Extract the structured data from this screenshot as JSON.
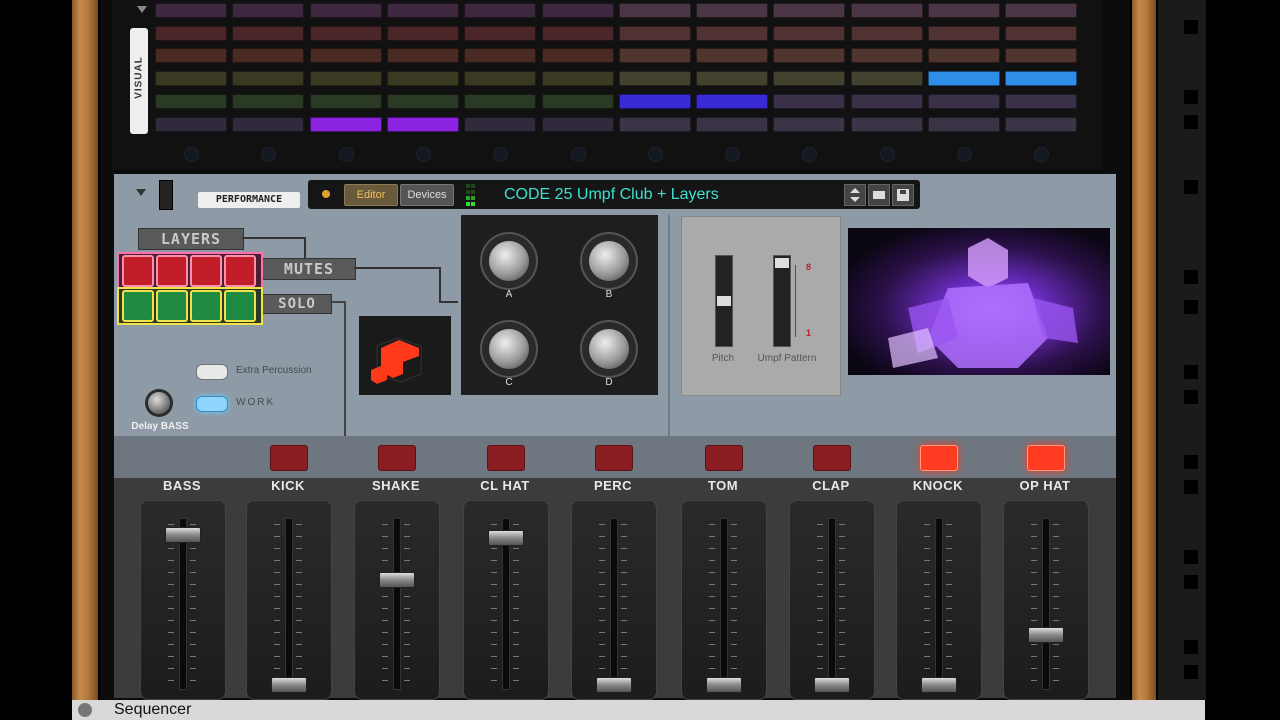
{
  "rack": {
    "visual_tab_label": "VISUAL",
    "grid_rows": [
      [
        "#3d2840",
        "#3d2840",
        "#3d2840",
        "#3d2840",
        "#3d2840",
        "#3d2840",
        "#4a3644",
        "#4a3644",
        "#4a3644",
        "#4a3644",
        "#4a3644",
        "#4a3644"
      ],
      [
        "#4a2628",
        "#4a2628",
        "#4a2628",
        "#4a2628",
        "#4a2628",
        "#4a2628",
        "#513232",
        "#513232",
        "#513232",
        "#513232",
        "#513232",
        "#513232"
      ],
      [
        "#4a2b24",
        "#4a2b24",
        "#4a2b24",
        "#4a2b24",
        "#4a2b24",
        "#4a2b24",
        "#50352e",
        "#50352e",
        "#50352e",
        "#50352e",
        "#50352e",
        "#50352e"
      ],
      [
        "#3a3a22",
        "#3a3a22",
        "#3a3a22",
        "#3a3a22",
        "#3a3a22",
        "#3a3a22",
        "#42422e",
        "#42422e",
        "#42422e",
        "#42422e",
        "#2e8ee8",
        "#2e8ee8"
      ],
      [
        "#2a3a24",
        "#2a3a24",
        "#2a3a24",
        "#2a3a24",
        "#2a3a24",
        "#2a3a24",
        "#3a2ad8",
        "#3a2ad8",
        "#3a3048",
        "#3a3048",
        "#3a3048",
        "#3a3048"
      ],
      [
        "#302a3c",
        "#302a3c",
        "#8a22e0",
        "#8a22e0",
        "#302a3c",
        "#302a3c",
        "#3a3446",
        "#3a3446",
        "#3a3446",
        "#3a3446",
        "#3a3446",
        "#3a3446"
      ]
    ]
  },
  "device": {
    "performance_label": "PERFORMANCE",
    "editor_tab": "Editor",
    "devices_tab": "Devices",
    "patch_name": "CODE 25 Umpf Club + Layers",
    "layers_label": "LAYERS",
    "mutes_label": "MUTES",
    "solo_label": "SOLO",
    "extra_percussion_label": "Extra Percussion",
    "work_label": "WORK",
    "delay_bass_label": "Delay BASS",
    "knob_labels": [
      "A",
      "B",
      "C",
      "D"
    ],
    "pitch_label": "Pitch",
    "umpf_pattern_label": "Umpf Pattern",
    "pattern_top": "8",
    "pattern_bottom": "1"
  },
  "mixer": {
    "channels": [
      {
        "name": "BASS",
        "mute_active": false,
        "level": 0.95
      },
      {
        "name": "KICK",
        "mute_active": false,
        "level": 0.02
      },
      {
        "name": "SHAKE",
        "mute_active": false,
        "level": 0.67
      },
      {
        "name": "CL HAT",
        "mute_active": false,
        "level": 0.93
      },
      {
        "name": "PERC",
        "mute_active": false,
        "level": 0.02
      },
      {
        "name": "TOM",
        "mute_active": false,
        "level": 0.02
      },
      {
        "name": "CLAP",
        "mute_active": false,
        "level": 0.02
      },
      {
        "name": "KNOCK",
        "mute_active": true,
        "level": 0.02
      },
      {
        "name": "OP HAT",
        "mute_active": true,
        "level": 0.33
      }
    ]
  },
  "footer": {
    "title": "Sequencer"
  },
  "colors": {
    "accent_teal": "#3ee0d0",
    "mute_on": "#ff3b22",
    "mute_off": "#8a1e22",
    "layer_pad_border": "#ff6fb0",
    "solo_pad_border": "#f2e24a"
  }
}
